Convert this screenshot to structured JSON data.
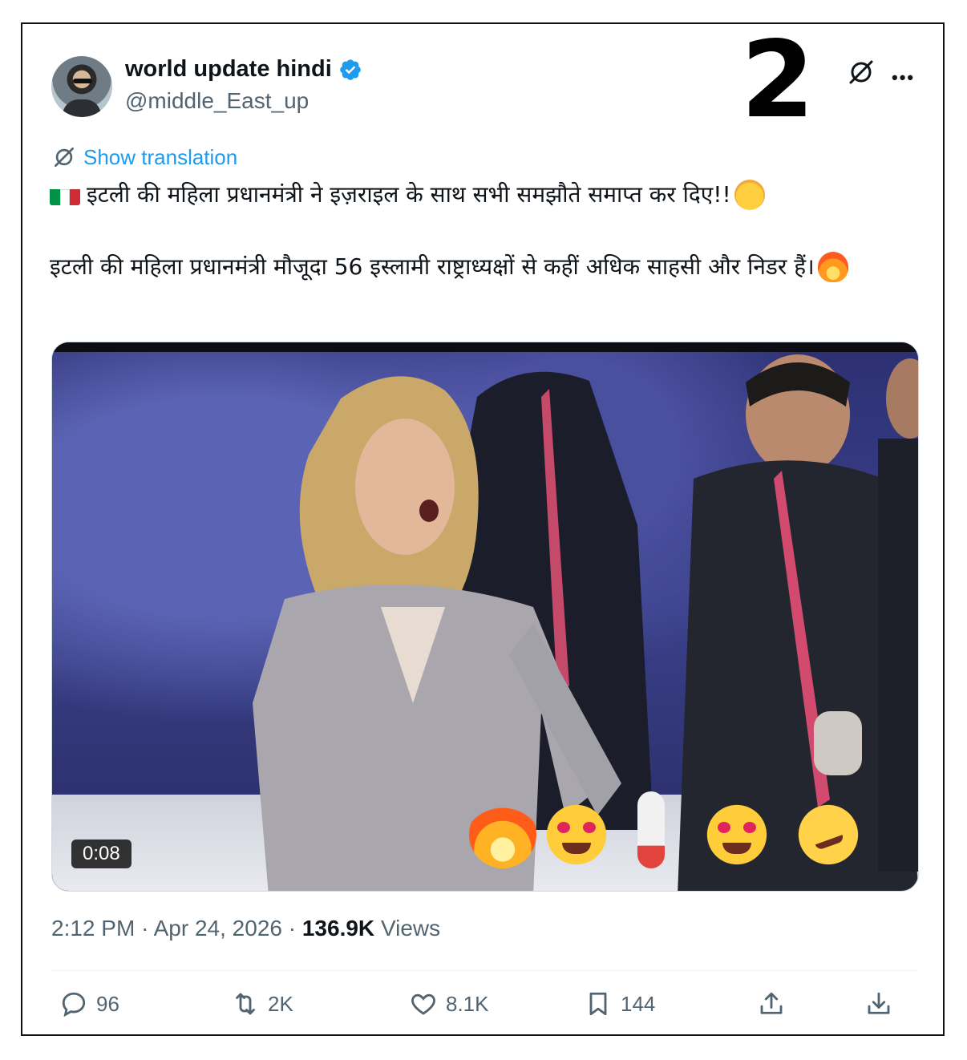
{
  "author": {
    "display_name": "world update hindi",
    "handle": "@middle_East_up",
    "verified": true
  },
  "overlay_number": "2",
  "header_icons": [
    "grok-icon",
    "more-icon"
  ],
  "translate_label": "Show translation",
  "tweet": {
    "line1": "इटली की महिला प्रधानमंत्री ने इज़राइल के साथ सभी समझौते समाप्त कर दिए!!",
    "line2": "इटली की महिला प्रधानमंत्री मौजूदा 56 इस्लामी राष्ट्राध्यक्षों से कहीं अधिक साहसी और निडर हैं।",
    "emojis": [
      "italy-flag",
      "saluting-face",
      "fire"
    ]
  },
  "video": {
    "duration": "0:08",
    "reactions": [
      "fire",
      "heart-eyes",
      "thermometer",
      "star-struck",
      "melting-face"
    ]
  },
  "meta": {
    "time": "2:12 PM",
    "date": "Apr 24, 2026",
    "views_count": "136.9K",
    "views_label": "Views"
  },
  "actions": {
    "replies": "96",
    "reposts": "2K",
    "likes": "8.1K",
    "bookmarks": "144"
  },
  "colors": {
    "accent": "#1d9bf0",
    "text": "#0f1419",
    "secondary": "#536471",
    "flag_green": "#009246",
    "flag_white": "#ffffff",
    "flag_red": "#ce2b37"
  }
}
